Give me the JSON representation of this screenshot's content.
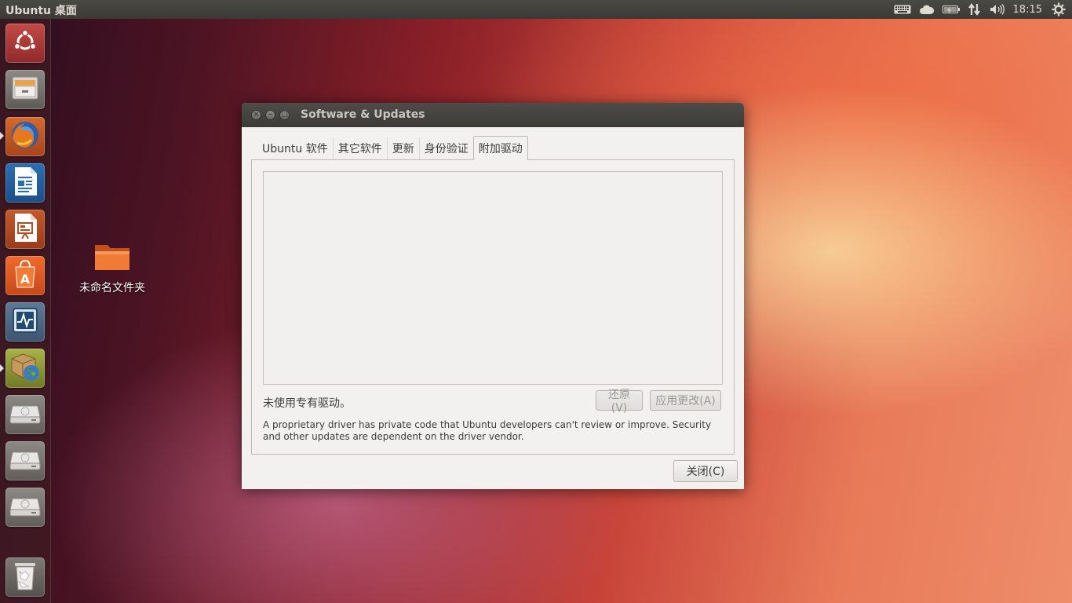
{
  "top_panel": {
    "title": "Ubuntu 桌面",
    "clock": "18:15",
    "indicators": [
      "keyboard-icon",
      "cloud-icon",
      "battery-icon",
      "network-updown-icon",
      "volume-icon"
    ]
  },
  "launcher": {
    "items": [
      {
        "name": "dash-home",
        "icon": "ubuntu-logo-icon"
      },
      {
        "name": "files",
        "icon": "file-cabinet-icon"
      },
      {
        "name": "firefox",
        "icon": "firefox-icon",
        "running": true
      },
      {
        "name": "libreoffice-writer",
        "icon": "writer-icon"
      },
      {
        "name": "libreoffice-impress",
        "icon": "impress-icon"
      },
      {
        "name": "software-center",
        "icon": "software-center-icon"
      },
      {
        "name": "system-monitor",
        "icon": "system-monitor-icon"
      },
      {
        "name": "software-updates",
        "icon": "software-updates-icon",
        "running": true
      },
      {
        "name": "drive-1",
        "icon": "drive-icon"
      },
      {
        "name": "drive-2",
        "icon": "drive-icon"
      },
      {
        "name": "drive-3",
        "icon": "drive-icon"
      },
      {
        "name": "trash",
        "icon": "trash-icon"
      }
    ]
  },
  "desktop": {
    "folder_label": "未命名文件夹"
  },
  "dialog": {
    "title": "Software & Updates",
    "tabs": [
      {
        "label": "Ubuntu 软件",
        "active": false
      },
      {
        "label": "其它软件",
        "active": false
      },
      {
        "label": "更新",
        "active": false
      },
      {
        "label": "身份验证",
        "active": false
      },
      {
        "label": "附加驱动",
        "active": true
      }
    ],
    "status": "未使用专有驱动。",
    "revert_label": "还原(V)",
    "apply_label": "应用更改(A)",
    "info": "A proprietary driver has private code that Ubuntu developers can't review or improve. Security and other updates are dependent on the driver vendor.",
    "close_label": "关闭(C)"
  },
  "colors": {
    "panel_bg": "#3c3b37",
    "launcher_bg": "#3e1c22",
    "dialog_bg": "#f2f1f0",
    "accent_orange": "#e95420"
  }
}
